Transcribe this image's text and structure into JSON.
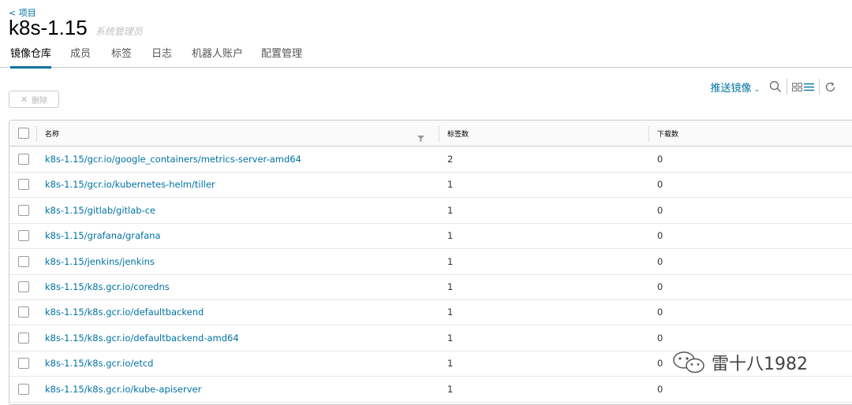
{
  "breadcrumb": "< 项目",
  "project": {
    "name": "k8s-1.15",
    "role": "系统管理员"
  },
  "tabs": [
    {
      "label": "镜像仓库",
      "active": true
    },
    {
      "label": "成员"
    },
    {
      "label": "标签"
    },
    {
      "label": "日志"
    },
    {
      "label": "机器人账户"
    },
    {
      "label": "配置管理"
    }
  ],
  "toolbar": {
    "push_image": "推送镜像",
    "delete": "删除",
    "icons": [
      "search-icon",
      "card-view-icon",
      "list-view-icon",
      "refresh-icon"
    ]
  },
  "table": {
    "columns": [
      "名称",
      "标签数",
      "下载数"
    ],
    "rows": [
      {
        "name": "k8s-1.15/gcr.io/google_containers/metrics-server-amd64",
        "tags": "2",
        "pulls": "0"
      },
      {
        "name": "k8s-1.15/gcr.io/kubernetes-helm/tiller",
        "tags": "1",
        "pulls": "0"
      },
      {
        "name": "k8s-1.15/gitlab/gitlab-ce",
        "tags": "1",
        "pulls": "0"
      },
      {
        "name": "k8s-1.15/grafana/grafana",
        "tags": "1",
        "pulls": "0"
      },
      {
        "name": "k8s-1.15/jenkins/jenkins",
        "tags": "1",
        "pulls": "0"
      },
      {
        "name": "k8s-1.15/k8s.gcr.io/coredns",
        "tags": "1",
        "pulls": "0"
      },
      {
        "name": "k8s-1.15/k8s.gcr.io/defaultbackend",
        "tags": "1",
        "pulls": "0"
      },
      {
        "name": "k8s-1.15/k8s.gcr.io/defaultbackend-amd64",
        "tags": "1",
        "pulls": "0"
      },
      {
        "name": "k8s-1.15/k8s.gcr.io/etcd",
        "tags": "1",
        "pulls": "0"
      },
      {
        "name": "k8s-1.15/k8s.gcr.io/kube-apiserver",
        "tags": "1",
        "pulls": "0"
      }
    ]
  },
  "watermark": "雷十八1982",
  "colors": {
    "link": "#0072a3",
    "border": "#cccccc",
    "header_bg": "#fafafa"
  }
}
